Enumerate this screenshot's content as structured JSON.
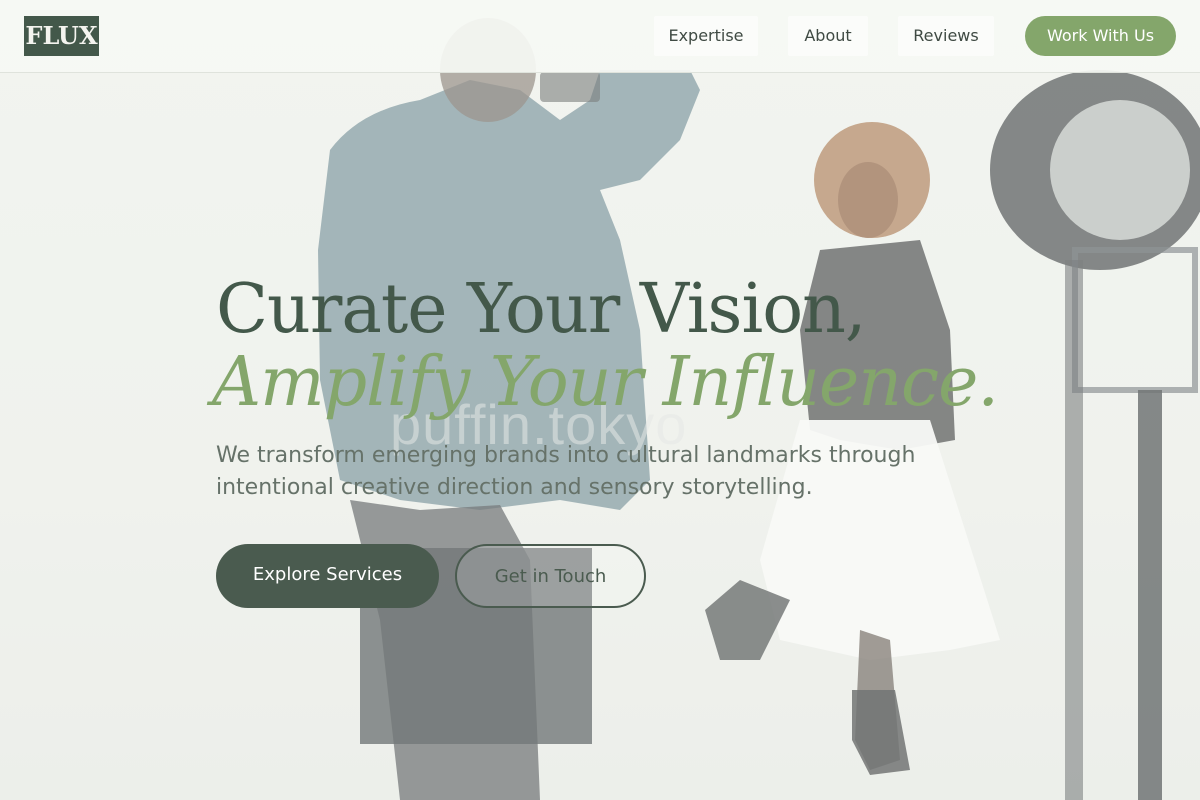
{
  "brand": {
    "logo_text": "FLUX"
  },
  "nav": {
    "links": [
      {
        "label": "Expertise"
      },
      {
        "label": "About"
      },
      {
        "label": "Reviews"
      }
    ],
    "cta_label": "Work With Us"
  },
  "hero": {
    "title_line1": "Curate Your Vision,",
    "title_line2": "Amplify Your Influence.",
    "subtitle": "We transform emerging brands into cultural landmarks through intentional creative direction and sensory storytelling.",
    "primary_button": "Explore Services",
    "secondary_button": "Get in Touch",
    "background_image": "photo-shoot-photographer-and-model"
  },
  "colors": {
    "brand_dark": "#43584a",
    "accent_green": "#84a66b",
    "body_text": "#667269"
  }
}
